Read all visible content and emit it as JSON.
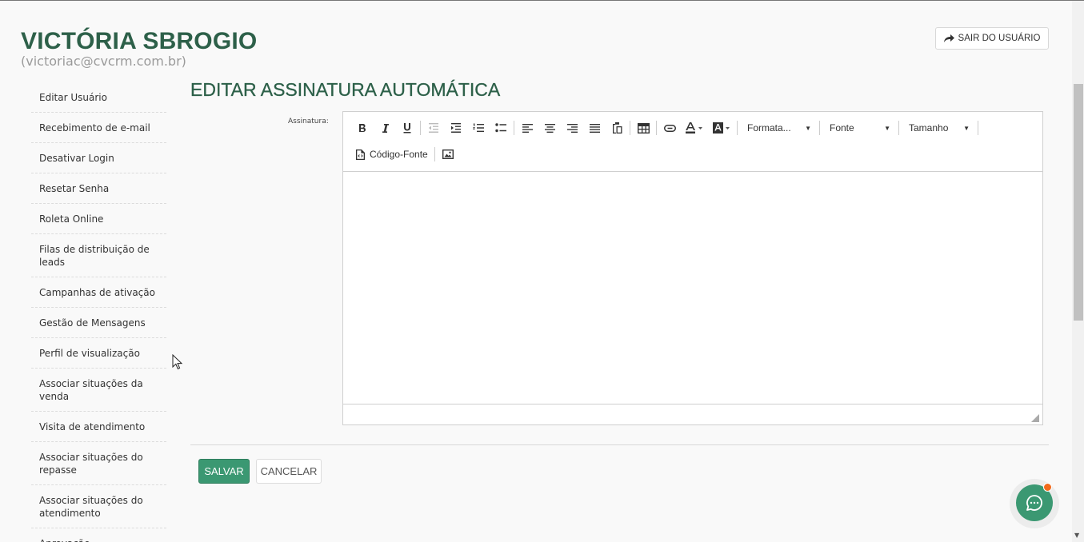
{
  "header": {
    "user_name": "VICTÓRIA SBROGIO",
    "user_email": "(victoriac@cvcrm.com.br)",
    "logout_label": "SAIR DO USUÁRIO"
  },
  "sidebar": {
    "items": [
      {
        "label": "Editar Usuário"
      },
      {
        "label": "Recebimento de e-mail"
      },
      {
        "label": "Desativar Login"
      },
      {
        "label": "Resetar Senha"
      },
      {
        "label": "Roleta Online"
      },
      {
        "label": "Filas de distribuição de leads"
      },
      {
        "label": "Campanhas de ativação"
      },
      {
        "label": "Gestão de Mensagens"
      },
      {
        "label": "Perfil de visualização"
      },
      {
        "label": "Associar situações da venda"
      },
      {
        "label": "Visita de atendimento"
      },
      {
        "label": "Associar situações do repasse"
      },
      {
        "label": "Associar situações do atendimento"
      },
      {
        "label": "Aprovação"
      }
    ]
  },
  "main": {
    "title": "EDITAR ASSINATURA AUTOMÁTICA",
    "field_label": "Assinatura:",
    "editor": {
      "format_select": "Formata...",
      "font_select": "Fonte",
      "size_select": "Tamanho",
      "source_label": "Código-Fonte",
      "content": ""
    },
    "buttons": {
      "save": "SALVAR",
      "cancel": "CANCELAR"
    }
  },
  "colors": {
    "brand_green": "#2d6049",
    "button_green": "#3b9872",
    "notification_dot": "#f26a1b"
  }
}
